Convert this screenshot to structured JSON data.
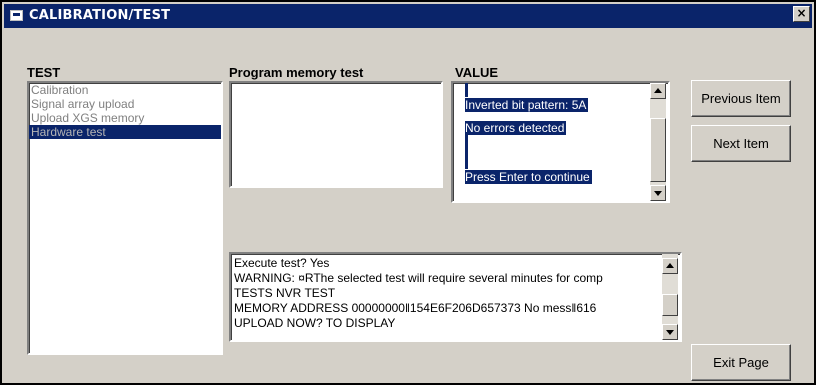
{
  "window": {
    "title": "CALIBRATION/TEST",
    "close_glyph": "×"
  },
  "test": {
    "label": "TEST",
    "items": [
      "Calibration",
      "Signal array upload",
      "Upload XGS memory",
      "Hardware test"
    ],
    "selected_index": 3
  },
  "program": {
    "label": "Program memory test"
  },
  "value": {
    "label": "VALUE",
    "lines": [
      "Inverted bit pattern: 5A",
      " No errors detected",
      "Press Enter to continue"
    ]
  },
  "log": {
    "lines": [
      "Execute test?  Yes",
      "WARNING:  ¤RThe selected test will require several minutes for comp",
      "TESTS  NVR TEST",
      "MEMORY  ADDRESS 00000000‖154E6F206D657373 No mess‖616",
      "UPLOAD NOW?  TO DISPLAY"
    ]
  },
  "buttons": {
    "previous": "Previous Item",
    "next": "Next Item",
    "exit": "Exit Page"
  },
  "icons": {
    "title": "window-icon",
    "close": "close-icon"
  }
}
